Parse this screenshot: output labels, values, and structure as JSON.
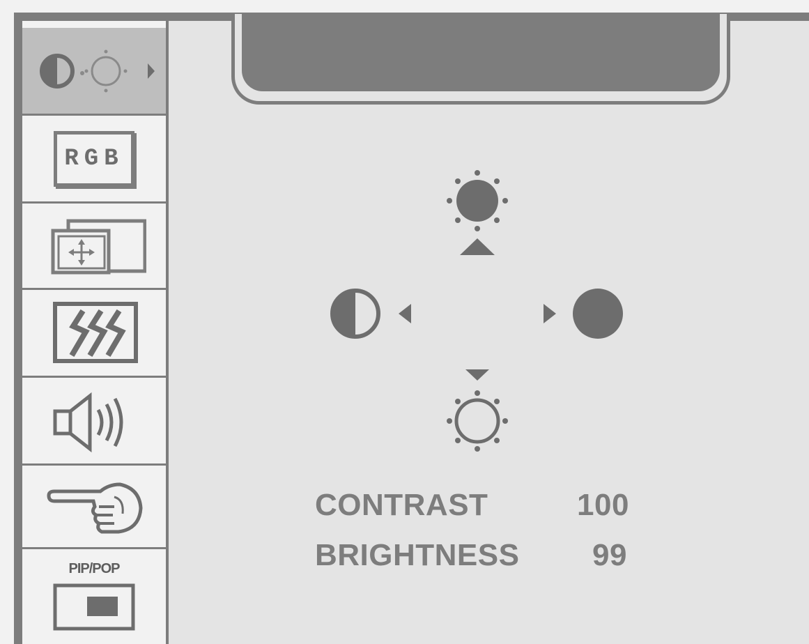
{
  "menu": {
    "tabs": [
      {
        "name": "picture",
        "icon": "contrast-brightness-icon",
        "selected": true
      },
      {
        "name": "color",
        "icon": "rgb-icon",
        "label": "RGB"
      },
      {
        "name": "position",
        "icon": "screen-position-icon"
      },
      {
        "name": "tracking",
        "icon": "tracking-icon"
      },
      {
        "name": "audio",
        "icon": "speaker-icon"
      },
      {
        "name": "setup",
        "icon": "pointing-hand-icon"
      },
      {
        "name": "pip-pop",
        "icon": "pip-pop-icon",
        "label": "PIP/POP"
      }
    ]
  },
  "controls": {
    "up": "brightness-up-icon",
    "down": "brightness-down-icon",
    "left": "contrast-low-icon",
    "right": "contrast-high-icon"
  },
  "readout": {
    "contrast_label": "CONTRAST",
    "contrast_value": "100",
    "brightness_label": "BRIGHTNESS",
    "brightness_value": "99"
  },
  "colors": {
    "frame": "#7d7d7d",
    "panel": "#e4e4e4",
    "sidebar": "#f2f2f2",
    "selected": "#bebebe"
  }
}
